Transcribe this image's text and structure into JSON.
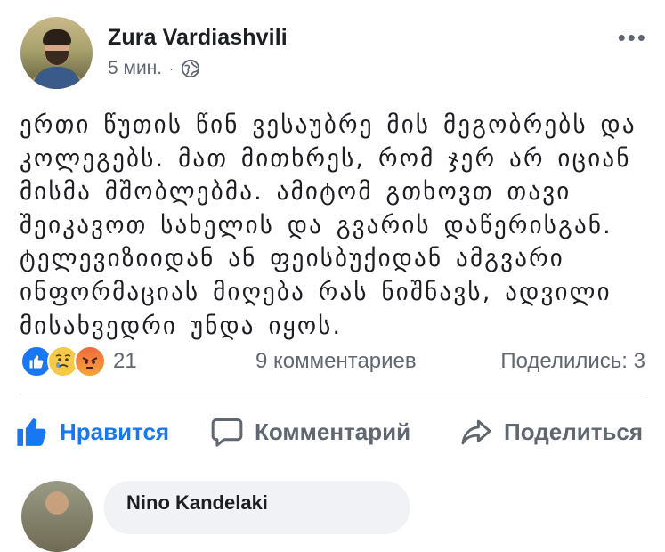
{
  "post": {
    "author": "Zura Vardiashvili",
    "time": "5 мин.",
    "separator": "·",
    "privacy_icon": "globe-icon",
    "more_icon": "more-options-icon",
    "more_label": "•••",
    "text_lines": [
      "ერთი წუთის წინ ვესაუბრე მის მეგობრებს და",
      "კოლეგებს. მათ მითხრეს, რომ ჯერ არ იციან",
      "მისმა მშობლებმა. ამიტომ გთხოვთ თავი",
      "შეიკავოთ სახელის და გვარის დაწერისგან.",
      "ტელევიზიიდან ან ფეისბუქიდან ამგვარი",
      "ინფორმაციას მიღება რას ნიშნავს, ადვილი",
      "მისახვედრი უნდა იყოს."
    ]
  },
  "reactions": {
    "types": [
      "like-reaction-icon",
      "sad-reaction-icon",
      "angry-reaction-icon"
    ],
    "count": "21",
    "comments": "9 комментариев",
    "shares": "Поделились: 3"
  },
  "actions": {
    "like_label": "Нравится",
    "comment_label": "Комментарий",
    "share_label": "Поделиться"
  },
  "comment_preview": {
    "name": "Nino Kandelaki"
  },
  "colors": {
    "accent": "#1877f2",
    "secondary_text": "#606770",
    "primary_text": "#1c1e21",
    "divider": "#dadde1",
    "comment_bg": "#f0f2f5"
  }
}
